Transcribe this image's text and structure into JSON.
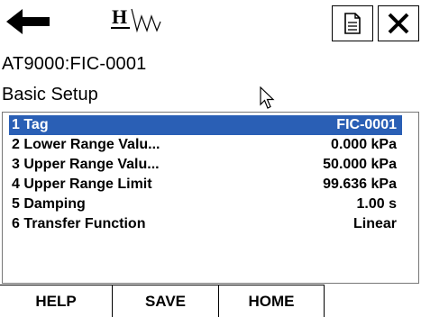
{
  "toolbar": {
    "back_icon": "back-arrow-icon",
    "logo": "HART",
    "document_icon": "document-icon",
    "close_icon": "close-icon"
  },
  "device_title": "AT9000:FIC-0001",
  "menu_title": "Basic Setup",
  "items": [
    {
      "label": "1 Tag",
      "value": "FIC-0001",
      "selected": true
    },
    {
      "label": "2 Lower Range Valu...",
      "value": "0.000 kPa",
      "selected": false
    },
    {
      "label": "3 Upper Range Valu...",
      "value": "50.000 kPa",
      "selected": false
    },
    {
      "label": "4 Upper Range Limit",
      "value": "99.636 kPa",
      "selected": false
    },
    {
      "label": "5 Damping",
      "value": "1.00 s",
      "selected": false
    },
    {
      "label": "6 Transfer Function",
      "value": "Linear",
      "selected": false
    }
  ],
  "buttons": {
    "help": "HELP",
    "save": "SAVE",
    "home": "HOME"
  },
  "colors": {
    "selection": "#2a5fb5",
    "background": "#ffffff"
  }
}
